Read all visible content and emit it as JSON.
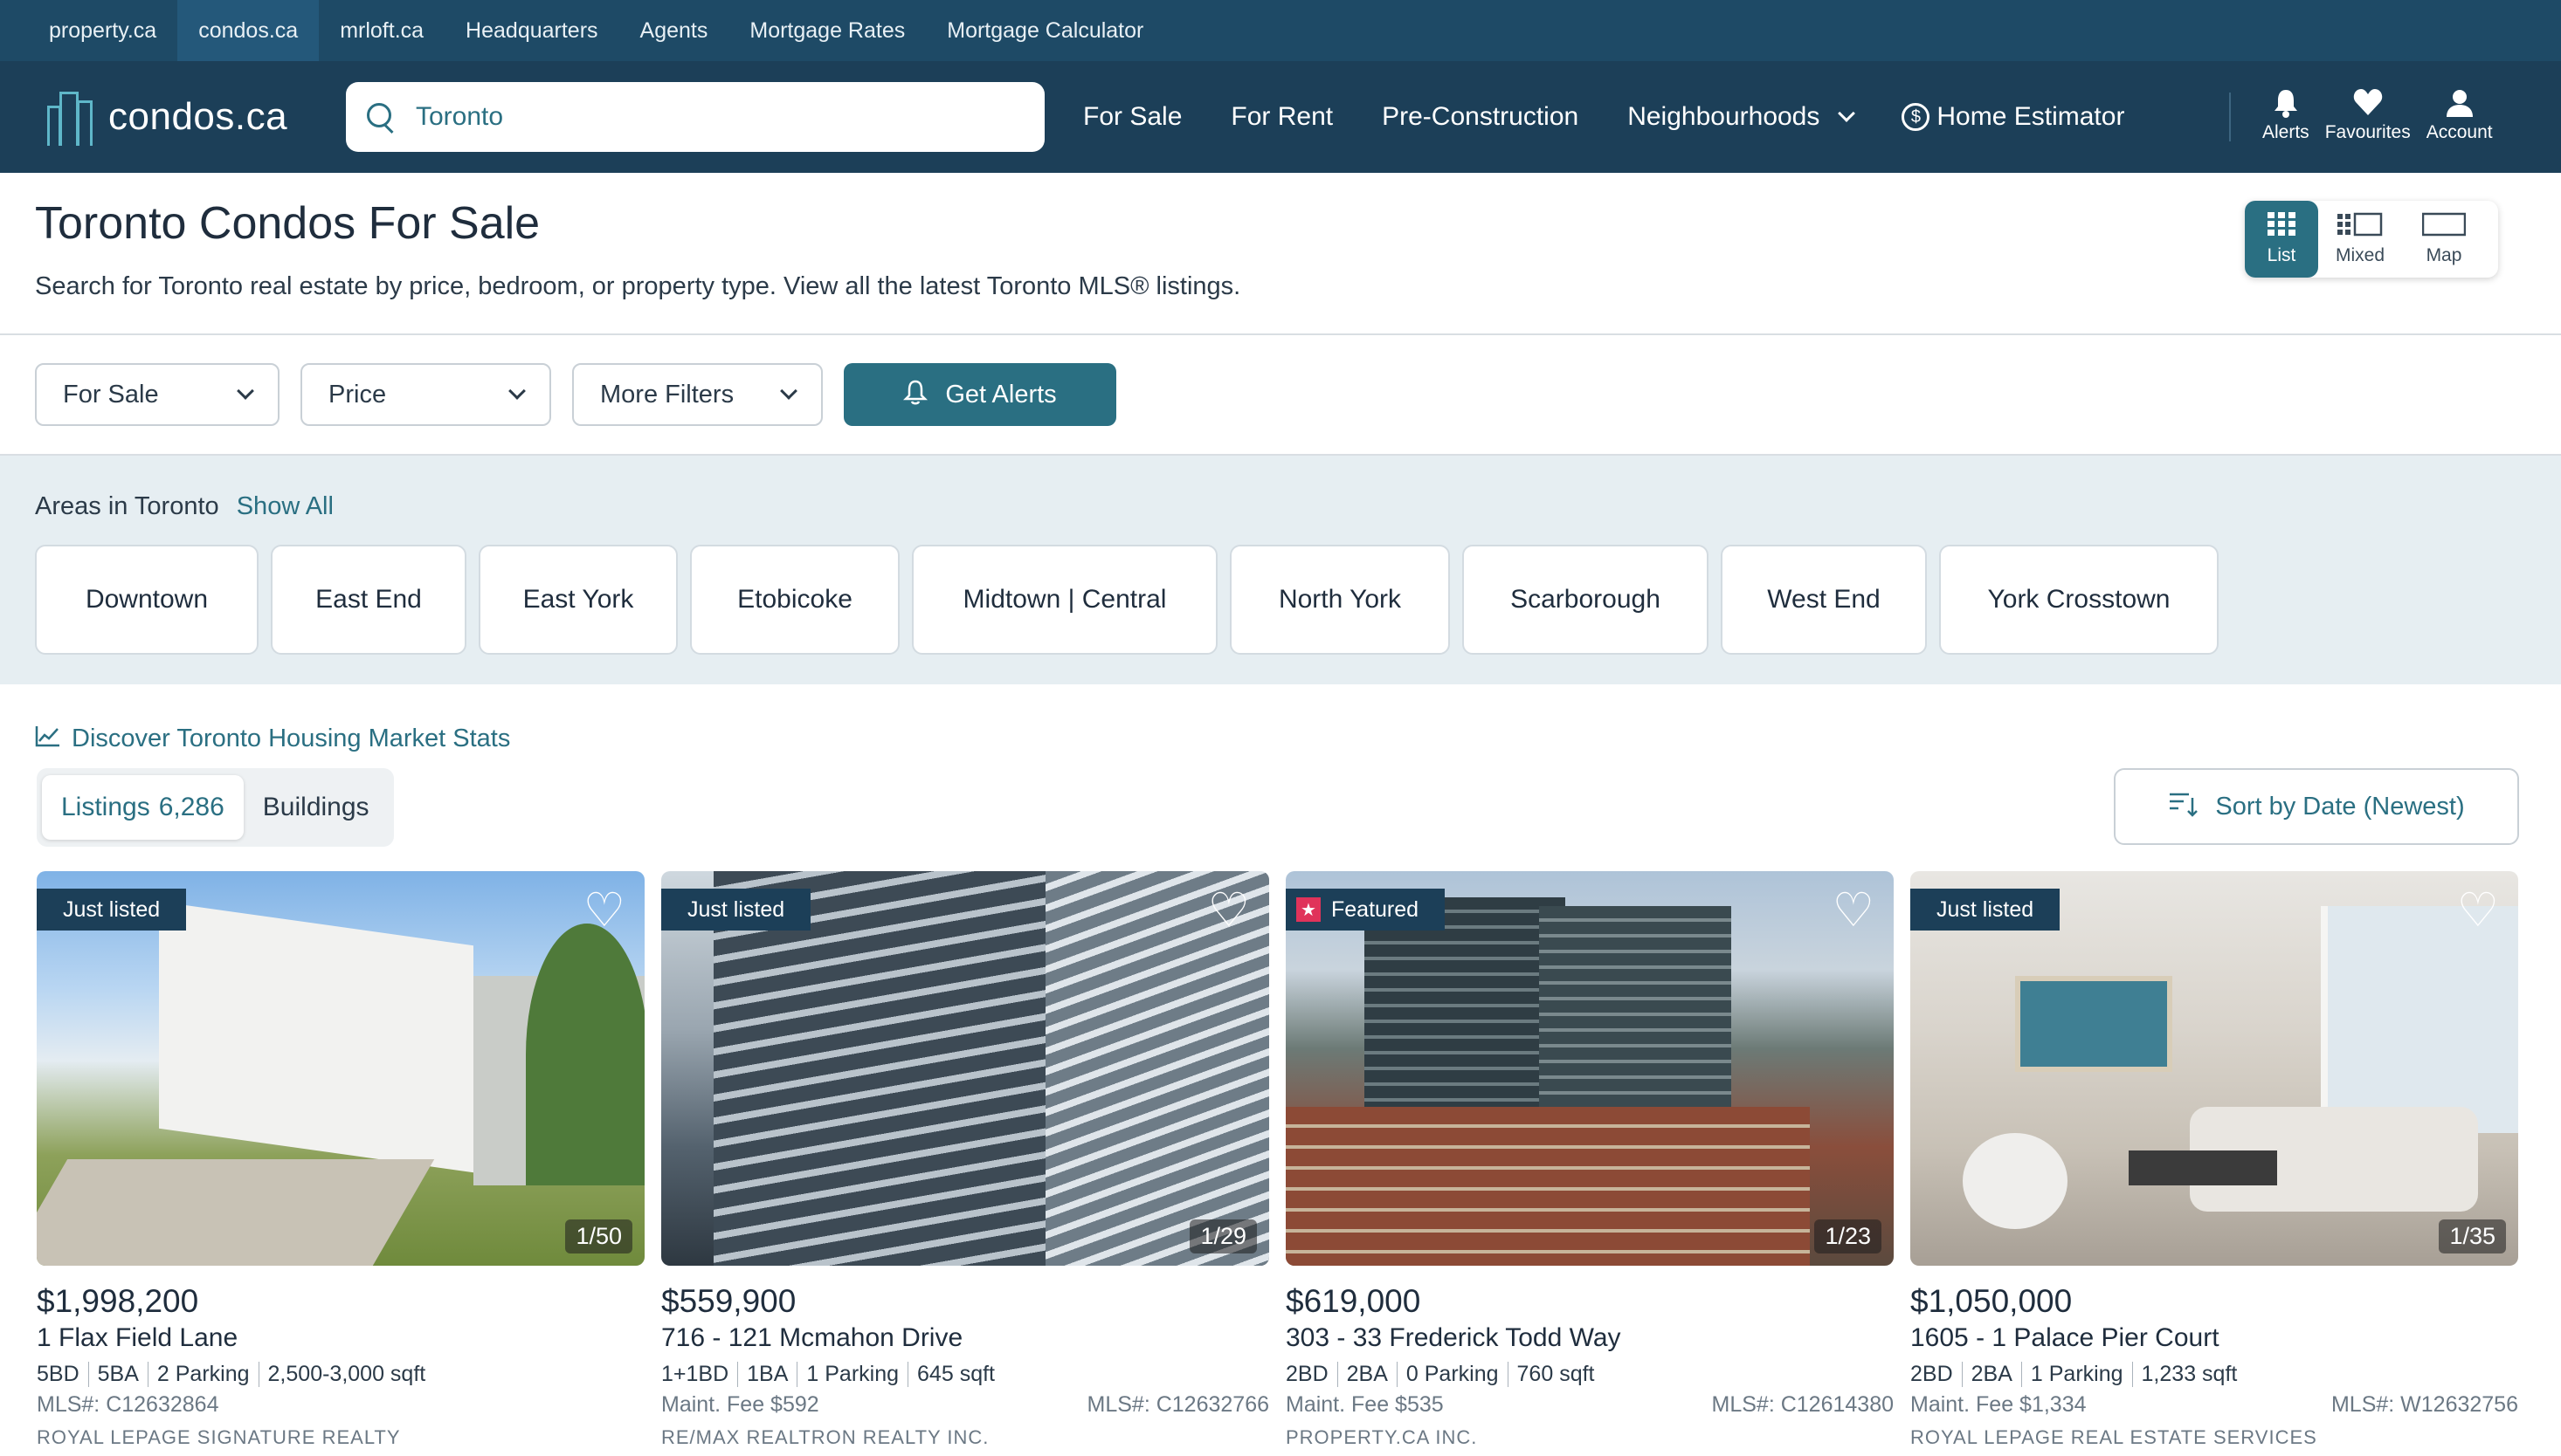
{
  "network": {
    "links": [
      "property.ca",
      "condos.ca",
      "mrloft.ca",
      "Headquarters",
      "Agents",
      "Mortgage Rates",
      "Mortgage Calculator"
    ],
    "active_index": 1
  },
  "header": {
    "logo_text": "condos.ca",
    "search_value": "Toronto",
    "nav": {
      "for_sale": "For Sale",
      "for_rent": "For Rent",
      "pre_construction": "Pre-Construction",
      "neighbourhoods": "Neighbourhoods",
      "home_estimator": "Home Estimator"
    },
    "icons": {
      "alerts": "Alerts",
      "favourites": "Favourites",
      "account": "Account"
    },
    "brand_color": "#1c3f58",
    "accent_color": "#2a6f82"
  },
  "page": {
    "title": "Toronto Condos For Sale",
    "subtitle": "Search for Toronto real estate by price, bedroom, or property type. View all the latest Toronto MLS® listings."
  },
  "view_toggle": {
    "list": "List",
    "mixed": "Mixed",
    "map": "Map",
    "active": "List"
  },
  "filters": {
    "type": "For Sale",
    "price": "Price",
    "more": "More Filters",
    "alerts_button": "Get Alerts"
  },
  "areas": {
    "label": "Areas in Toronto",
    "show_all": "Show All",
    "items": [
      "Downtown",
      "East End",
      "East York",
      "Etobicoke",
      "Midtown | Central",
      "North York",
      "Scarborough",
      "West End",
      "York Crosstown"
    ]
  },
  "stats_link": "Discover Toronto Housing Market Stats",
  "tabs": {
    "listings_label": "Listings",
    "listings_count": "6,286",
    "buildings_label": "Buildings"
  },
  "sort": {
    "label": "Sort by Date (Newest)"
  },
  "listings": [
    {
      "badge": "Just listed",
      "featured": false,
      "photo_count": "1/50",
      "price": "$1,998,200",
      "address": "1 Flax Field Lane",
      "specs": [
        "5BD",
        "5BA",
        "2 Parking",
        "2,500-3,000 sqft"
      ],
      "fee": "",
      "mls": "MLS#: C12632864",
      "brokerage": "ROYAL LEPAGE SIGNATURE REALTY"
    },
    {
      "badge": "Just listed",
      "featured": false,
      "photo_count": "1/29",
      "price": "$559,900",
      "address": "716 - 121 Mcmahon Drive",
      "specs": [
        "1+1BD",
        "1BA",
        "1 Parking",
        "645 sqft"
      ],
      "fee": "Maint. Fee $592",
      "mls": "MLS#: C12632766",
      "brokerage": "RE/MAX REALTRON REALTY INC."
    },
    {
      "badge": "Featured",
      "featured": true,
      "photo_count": "1/23",
      "price": "$619,000",
      "address": "303 - 33 Frederick Todd Way",
      "specs": [
        "2BD",
        "2BA",
        "0 Parking",
        "760 sqft"
      ],
      "fee": "Maint. Fee $535",
      "mls": "MLS#: C12614380",
      "brokerage": "PROPERTY.CA INC."
    },
    {
      "badge": "Just listed",
      "featured": false,
      "photo_count": "1/35",
      "price": "$1,050,000",
      "address": "1605 - 1 Palace Pier Court",
      "specs": [
        "2BD",
        "2BA",
        "1 Parking",
        "1,233 sqft"
      ],
      "fee": "Maint. Fee $1,334",
      "mls": "MLS#: W12632756",
      "brokerage": "ROYAL LEPAGE REAL ESTATE SERVICES"
    }
  ]
}
